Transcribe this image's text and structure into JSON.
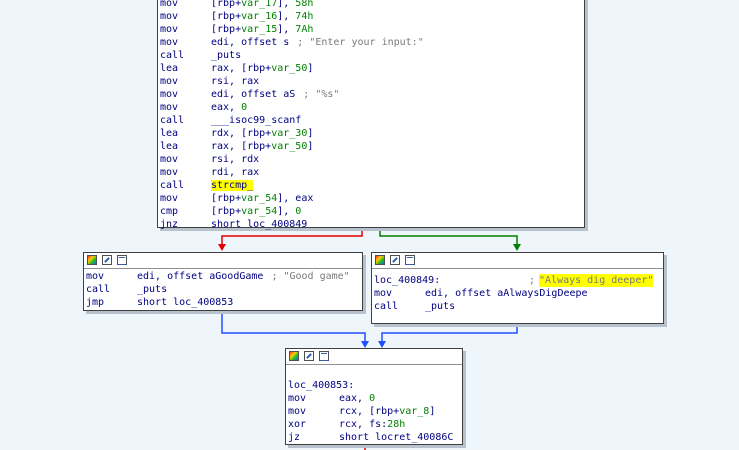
{
  "block_top": {
    "lines": [
      {
        "mn": "mov",
        "ops": "[rbp+var_17], 58h"
      },
      {
        "mn": "mov",
        "ops": "[rbp+var_16], 74h"
      },
      {
        "mn": "mov",
        "ops": "[rbp+var_15], 7Ah"
      },
      {
        "mn": "mov",
        "ops": "edi, offset s",
        "comment": "; \"Enter your input:\""
      },
      {
        "mn": "call",
        "ops": "_puts"
      },
      {
        "mn": "lea",
        "ops": "rax, [rbp+var_50]"
      },
      {
        "mn": "mov",
        "ops": "rsi, rax"
      },
      {
        "mn": "mov",
        "ops": "edi, offset aS",
        "comment": "; \"%s\""
      },
      {
        "mn": "mov",
        "ops": "eax, 0"
      },
      {
        "mn": "call",
        "ops": "___isoc99_scanf"
      },
      {
        "mn": "lea",
        "ops": "rdx, [rbp+var_30]"
      },
      {
        "mn": "lea",
        "ops": "rax, [rbp+var_50]"
      },
      {
        "mn": "mov",
        "ops": "rsi, rdx"
      },
      {
        "mn": "mov",
        "ops": "rdi, rax"
      },
      {
        "mn": "call",
        "ops": "strcmp_"
      },
      {
        "mn": "mov",
        "ops": "[rbp+var_54], eax"
      },
      {
        "mn": "cmp",
        "ops": "[rbp+var_54], 0"
      },
      {
        "mn": "jnz",
        "ops": "short loc_400849"
      }
    ]
  },
  "block_good": {
    "lines": [
      {
        "mn": "mov",
        "ops": "edi, offset aGoodGame",
        "comment": "; \"Good game\""
      },
      {
        "mn": "call",
        "ops": "_puts"
      },
      {
        "mn": "jmp",
        "ops": "short loc_400853"
      }
    ]
  },
  "block_deeper": {
    "label": "loc_400849:",
    "label_comment": "; ",
    "highlight_comment": "\"Always dig deeper\"",
    "lines": [
      {
        "mn": "mov",
        "ops": "edi, offset aAlwaysDigDeepe"
      },
      {
        "mn": "call",
        "ops": "_puts"
      }
    ]
  },
  "block_end": {
    "label": "loc_400853:",
    "lines": [
      {
        "mn": "mov",
        "ops": "eax, 0"
      },
      {
        "mn": "mov",
        "ops": "rcx, [rbp+var_8]"
      },
      {
        "mn": "xor",
        "ops": "rcx, fs:28h"
      },
      {
        "mn": "jz",
        "ops": "short locret_40086C"
      }
    ]
  },
  "colors": {
    "edge_false": "#e00000",
    "edge_true": "#008000",
    "edge_uncond": "#2050ff",
    "highlight": "#ffff00"
  }
}
